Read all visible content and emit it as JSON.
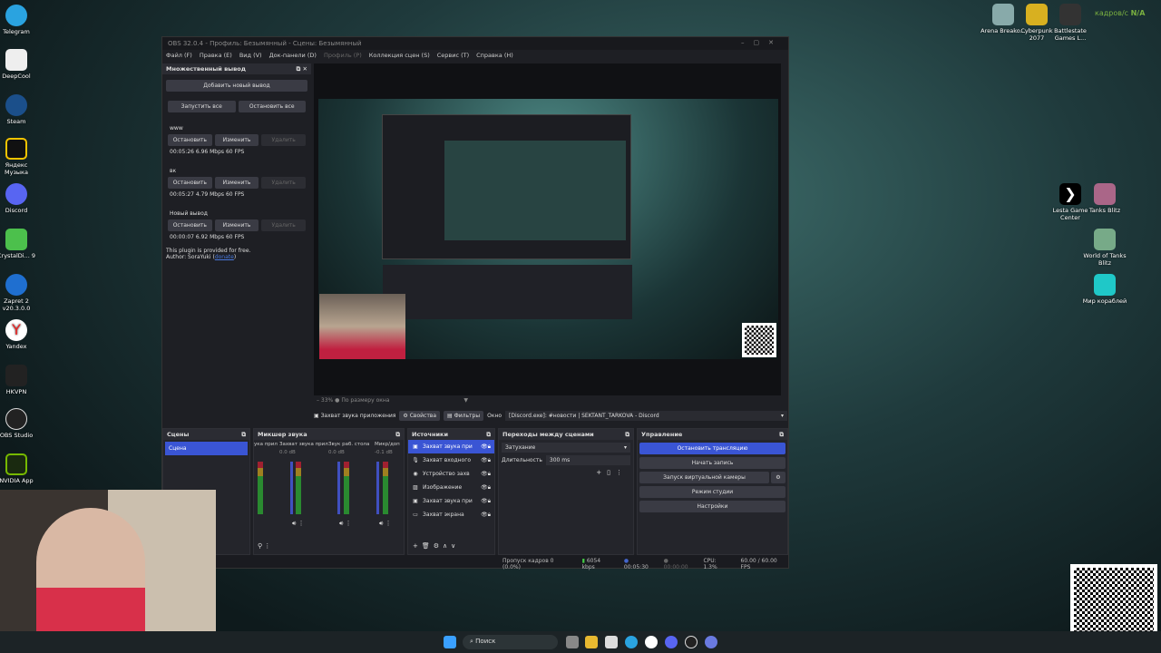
{
  "desktop": {
    "left_icons": [
      "Telegram",
      "DeepCool",
      "Steam",
      "Яндекс Музыка",
      "Discord",
      "CrystalDi... 9",
      "Zapret 2 v20.3.0.0",
      "Yandex",
      "HKVPN",
      "OBS Studio",
      "NVIDIA App"
    ],
    "top_right_icons": [
      "Arena Breako...",
      "Cyberpunk 2077",
      "Battlestate Games L..."
    ],
    "right_icons": [
      "Lesta Game Center",
      "Tanks Blitz",
      "World of Tanks Blitz",
      "Мир кораблей"
    ],
    "fps_overlay_label": "кадров/с",
    "fps_overlay_value": "N/A",
    "accent": "#3a55d4"
  },
  "obs": {
    "title": "OBS 32.0.4 - Профиль: Безымянный - Сцены: Безымянный",
    "menu": [
      "Файл (F)",
      "Правка (E)",
      "Вид (V)",
      "Док-панели (D)",
      "Профиль (P)",
      "Коллекция сцен (S)",
      "Сервис (T)",
      "Справка (H)"
    ],
    "multi": {
      "title": "Множественный вывод",
      "add": "Добавить новый вывод",
      "start_all": "Запустить все",
      "stop_all": "Остановить все",
      "outputs": [
        {
          "name": "www",
          "stop": "Остановить",
          "edit": "Изменить",
          "delete": "Удалить",
          "stats": "00:05:26  6.96 Mbps  60 FPS"
        },
        {
          "name": "вк",
          "stop": "Остановить",
          "edit": "Изменить",
          "delete": "Удалить",
          "stats": "00:05:27  4.79 Mbps  60 FPS"
        },
        {
          "name": "Новый вывод",
          "stop": "Остановить",
          "edit": "Изменить",
          "delete": "Удалить",
          "stats": "00:00:07  6.92 Mbps  60 FPS"
        }
      ],
      "footer1": "This plugin is provided for free.",
      "footer2": "Author: SoraYuki (",
      "footer_link": "donate",
      "footer3": ")"
    },
    "zoom": {
      "value": "33%",
      "fit": "По размеру окна"
    },
    "source_bar": {
      "source": "Захват звука приложения",
      "properties": "Свойства",
      "filters": "Фильтры",
      "window_label": "Окно",
      "window_value": "[Discord.exe]: #новости | SEKTANT_TARKOVA - Discord"
    },
    "scenes": {
      "title": "Сцены",
      "items": [
        "Сцена"
      ]
    },
    "mixer": {
      "title": "Микшер звука",
      "channels": [
        {
          "name": "ука прил",
          "db": ""
        },
        {
          "name": "Захват звука прил",
          "db": "0.0 dB"
        },
        {
          "name": "Звук раб. стола",
          "db": "0.0 dB"
        },
        {
          "name": "Микр/доп",
          "db": "-0.1 dB"
        }
      ]
    },
    "sources": {
      "title": "Источники",
      "items": [
        {
          "name": "Захват звука при",
          "icon": "app-audio"
        },
        {
          "name": "Захват входного",
          "icon": "mic"
        },
        {
          "name": "Устройство захв",
          "icon": "camera"
        },
        {
          "name": "Изображение",
          "icon": "image"
        },
        {
          "name": "Захват звука при",
          "icon": "app-audio"
        },
        {
          "name": "Захват экрана",
          "icon": "monitor"
        }
      ]
    },
    "transitions": {
      "title": "Переходы между сценами",
      "type": "Затухание",
      "duration_label": "Длительность",
      "duration": "300 ms"
    },
    "controls": {
      "title": "Управление",
      "stop_stream": "Остановить трансляцию",
      "record": "Начать запись",
      "virtual_cam": "Запуск виртуальной камеры",
      "studio": "Режим студии",
      "settings": "Настройки"
    },
    "status": {
      "dropped": "Пропуск кадров 0 (0.0%)",
      "bitrate": "6054 kbps",
      "stream_time": "00:05:30",
      "rec_time": "00:00:00",
      "cpu": "CPU: 1.3%",
      "fps": "60.00 / 60.00 FPS"
    }
  },
  "taskbar": {
    "search": "Поиск"
  }
}
